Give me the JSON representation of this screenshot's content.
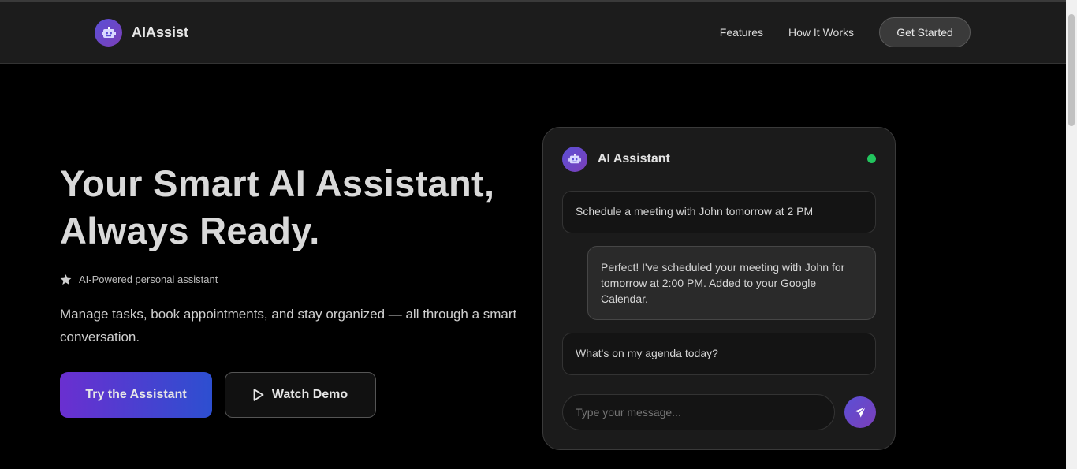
{
  "brand": {
    "name": "AIAssist",
    "logo_icon": "robot-icon"
  },
  "nav": {
    "links": [
      "Features",
      "How It Works"
    ],
    "cta_label": "Get Started"
  },
  "hero": {
    "title_line1": "Your Smart AI Assistant,",
    "title_line2": "Always Ready.",
    "badge_icon": "star-icon",
    "badge_text": "AI-Powered personal assistant",
    "description": "Manage tasks, book appointments, and stay organized — all through a smart conversation.",
    "primary_button": "Try the Assistant",
    "secondary_button": "Watch Demo"
  },
  "chat": {
    "title": "AI Assistant",
    "status_color": "#22c55e",
    "messages": [
      {
        "role": "user",
        "text": "Schedule a meeting with John tomorrow at 2 PM"
      },
      {
        "role": "assistant",
        "text": "Perfect! I've scheduled your meeting with John for tomorrow at 2:00 PM. Added to your Google Calendar."
      },
      {
        "role": "user",
        "text": "What's on my agenda today?"
      }
    ],
    "input_placeholder": "Type your message...",
    "send_icon": "send-icon"
  },
  "colors": {
    "accent_purple": "#6a2fd0",
    "accent_blue": "#2d4fd0",
    "background": "#000000",
    "card": "#1b1b1b"
  }
}
